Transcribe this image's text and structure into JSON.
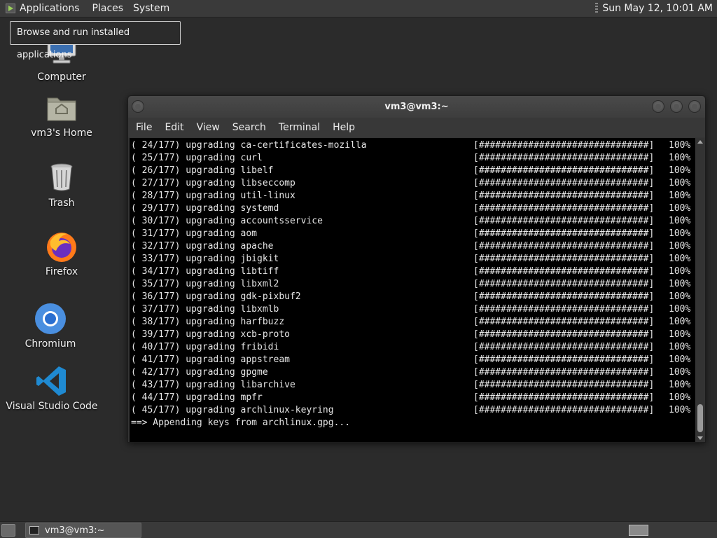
{
  "top_panel": {
    "menus": [
      "Applications",
      "Places",
      "System"
    ],
    "clock": "Sun May 12, 10:01 AM"
  },
  "tooltip": "Browse and run installed applications",
  "desktop_icons": [
    {
      "label": "Computer",
      "icon": "computer-icon"
    },
    {
      "label": "vm3's Home",
      "icon": "home-folder-icon"
    },
    {
      "label": "Trash",
      "icon": "trash-icon"
    },
    {
      "label": "Firefox",
      "icon": "firefox-icon"
    },
    {
      "label": "Chromium",
      "icon": "chromium-icon"
    },
    {
      "label": "Visual Studio Code",
      "icon": "vscode-icon"
    }
  ],
  "terminal": {
    "title": "vm3@vm3:~",
    "menu": [
      "File",
      "Edit",
      "View",
      "Search",
      "Terminal",
      "Help"
    ],
    "progress_bar": "[###############################]",
    "lines": [
      {
        "text": "( 24/177) upgrading ca-certificates-mozilla",
        "pct": "100%"
      },
      {
        "text": "( 25/177) upgrading curl",
        "pct": "100%"
      },
      {
        "text": "( 26/177) upgrading libelf",
        "pct": "100%"
      },
      {
        "text": "( 27/177) upgrading libseccomp",
        "pct": "100%"
      },
      {
        "text": "( 28/177) upgrading util-linux",
        "pct": "100%"
      },
      {
        "text": "( 29/177) upgrading systemd",
        "pct": "100%"
      },
      {
        "text": "( 30/177) upgrading accountsservice",
        "pct": "100%"
      },
      {
        "text": "( 31/177) upgrading aom",
        "pct": "100%"
      },
      {
        "text": "( 32/177) upgrading apache",
        "pct": "100%"
      },
      {
        "text": "( 33/177) upgrading jbigkit",
        "pct": "100%"
      },
      {
        "text": "( 34/177) upgrading libtiff",
        "pct": "100%"
      },
      {
        "text": "( 35/177) upgrading libxml2",
        "pct": "100%"
      },
      {
        "text": "( 36/177) upgrading gdk-pixbuf2",
        "pct": "100%"
      },
      {
        "text": "( 37/177) upgrading libxmlb",
        "pct": "100%"
      },
      {
        "text": "( 38/177) upgrading harfbuzz",
        "pct": "100%"
      },
      {
        "text": "( 39/177) upgrading xcb-proto",
        "pct": "100%"
      },
      {
        "text": "( 40/177) upgrading fribidi",
        "pct": "100%"
      },
      {
        "text": "( 41/177) upgrading appstream",
        "pct": "100%"
      },
      {
        "text": "( 42/177) upgrading gpgme",
        "pct": "100%"
      },
      {
        "text": "( 43/177) upgrading libarchive",
        "pct": "100%"
      },
      {
        "text": "( 44/177) upgrading mpfr",
        "pct": "100%"
      },
      {
        "text": "( 45/177) upgrading archlinux-keyring",
        "pct": "100%"
      }
    ],
    "last_line": "==> Appending keys from archlinux.gpg..."
  },
  "taskbar": {
    "window_button": "vm3@vm3:~"
  },
  "colors": {
    "desktop_bg": "#2b2b2b",
    "panel_bg": "#3a3a3a",
    "terminal_bg": "#000000"
  }
}
